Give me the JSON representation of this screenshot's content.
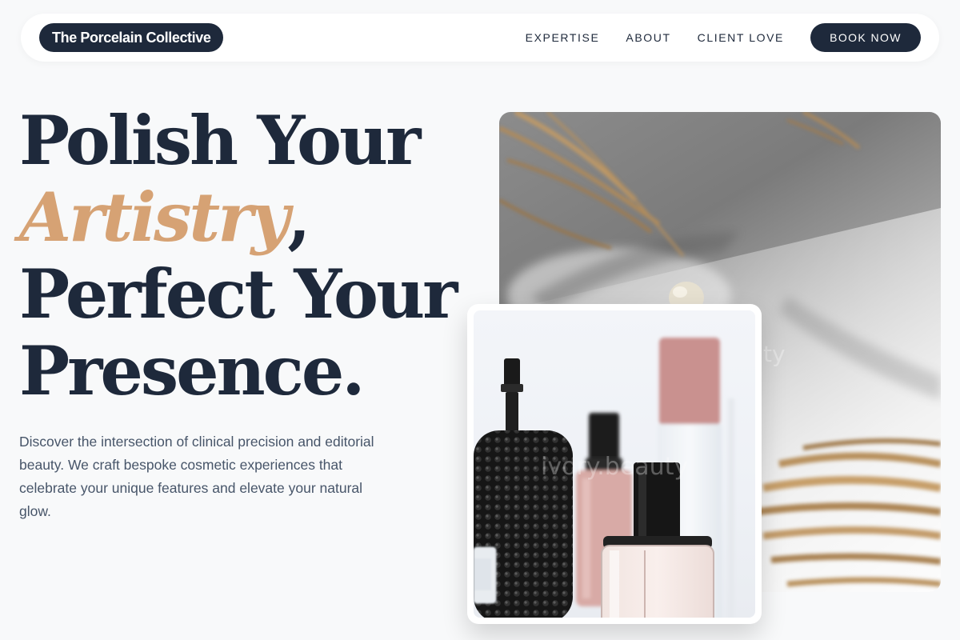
{
  "nav": {
    "brand": "The Porcelain Collective",
    "links": [
      "EXPERTISE",
      "ABOUT",
      "CLIENT LOVE"
    ],
    "cta": "BOOK NOW"
  },
  "hero": {
    "headline_line1": "Polish Your",
    "headline_accent": "Artistry",
    "headline_comma": ",",
    "headline_line3": "Perfect Your",
    "headline_line4": "Presence.",
    "intro": "Discover the intersection of clinical precision and editorial beauty. We craft bespoke cosmetic experiences that celebrate your unique features and elevate your natural glow."
  },
  "images": {
    "back_watermark": "ty",
    "front_watermark": "ivory.beauty"
  },
  "colors": {
    "navy": "#1e293b",
    "accent": "#d6a274",
    "body_text": "#475569",
    "background": "#f8f9fa"
  }
}
